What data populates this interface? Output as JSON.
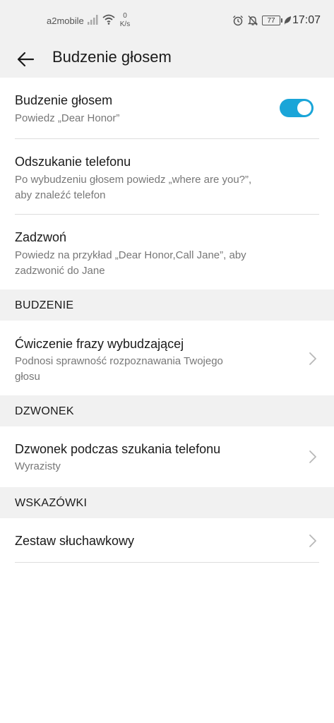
{
  "status_bar": {
    "carrier": "a2mobile",
    "net_speed_value": "0",
    "net_speed_unit": "K/s",
    "battery": "77",
    "time": "17:07",
    "icons": [
      "signal-icon",
      "wifi-icon",
      "alarm-icon",
      "bell-off-icon",
      "battery-icon",
      "leaf-icon"
    ]
  },
  "app_bar": {
    "title": "Budzenie głosem",
    "back_icon": "arrow-left-icon"
  },
  "settings": {
    "voice_wakeup": {
      "title": "Budzenie głosem",
      "subtitle": "Powiedz „Dear Honor”",
      "enabled": true,
      "toggle_color": "#1aa5d8"
    },
    "find_phone": {
      "title": "Odszukanie telefonu",
      "subtitle_line1": "Po wybudzeniu głosem powiedz „where are you?”,",
      "subtitle_line2": "aby znaleźć telefon"
    },
    "call": {
      "title": "Zadzwoń",
      "subtitle_line1": "Powiedz na przykład „Dear Honor,Call Jane”, aby",
      "subtitle_line2": "zadzwonić do Jane"
    }
  },
  "sections": {
    "wakeup": {
      "header": "BUDZENIE",
      "training": {
        "title": "Ćwiczenie frazy wybudzającej",
        "subtitle_line1": "Podnosi sprawność rozpoznawania Twojego",
        "subtitle_line2": "głosu"
      }
    },
    "ringtone": {
      "header": "DZWONEK",
      "find_ringtone": {
        "title": "Dzwonek podczas szukania telefonu",
        "subtitle": "Wyrazisty"
      }
    },
    "tips": {
      "header": "WSKAZÓWKI",
      "headset": {
        "title": "Zestaw słuchawkowy"
      }
    }
  }
}
